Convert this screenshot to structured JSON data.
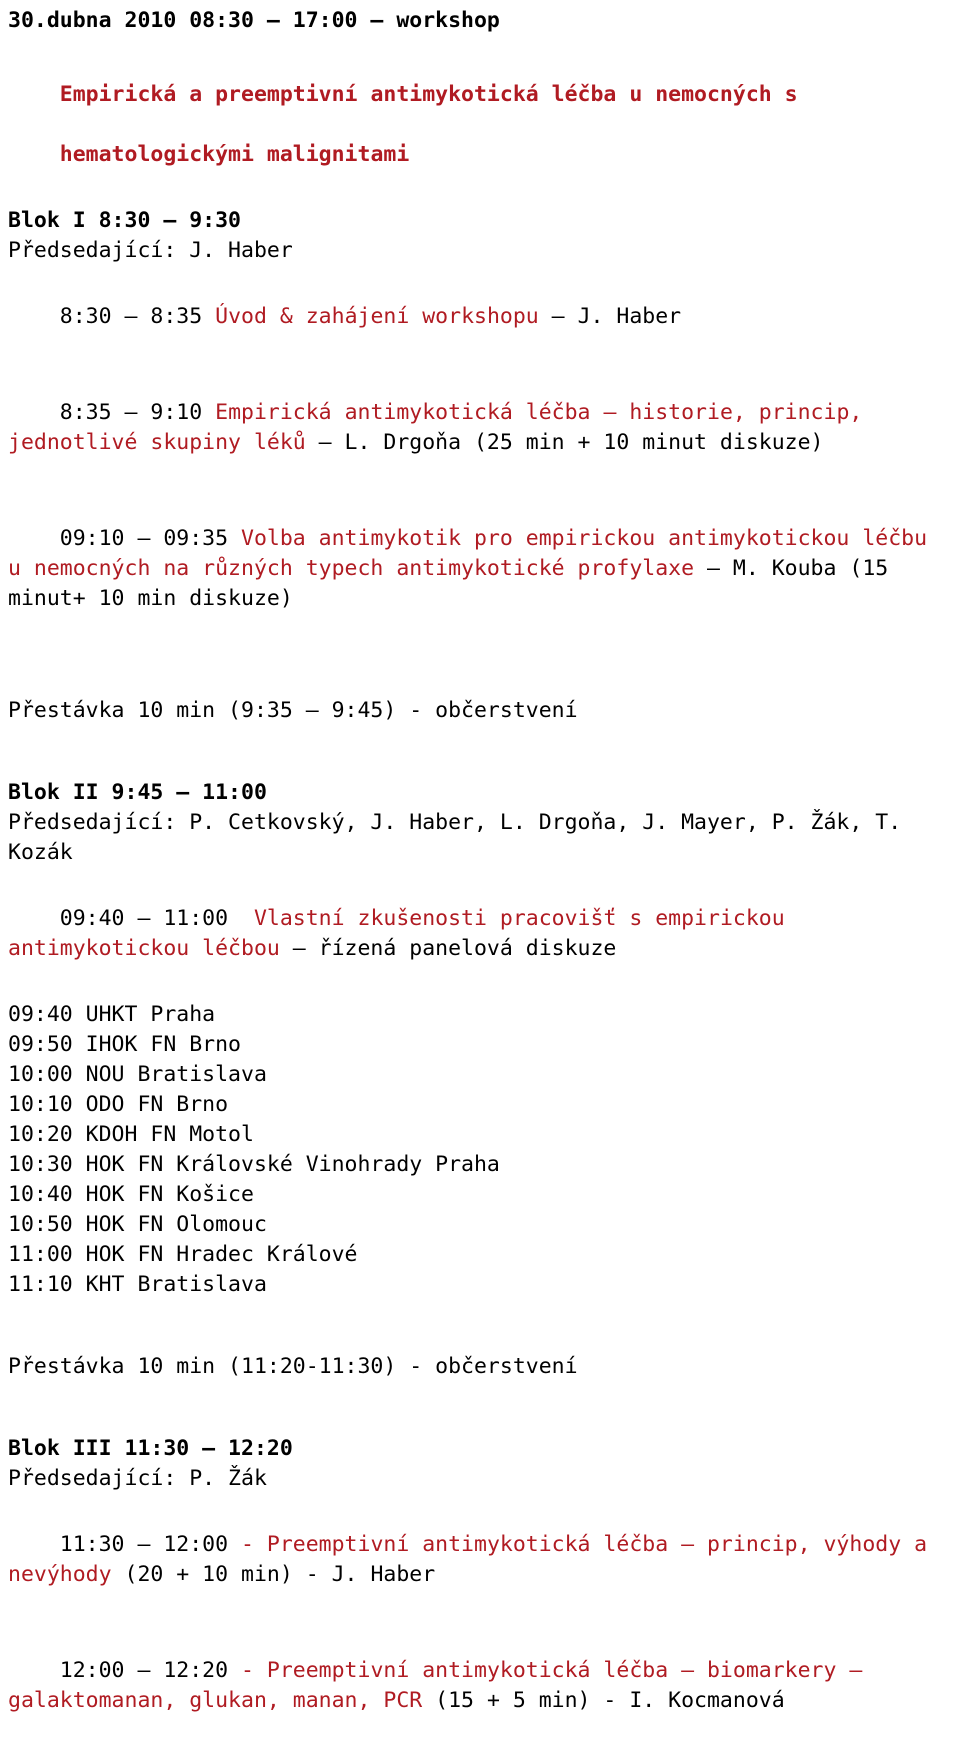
{
  "document": {
    "header_line": "30.dubna 2010 08:30 – 17:00 – workshop",
    "title_line_1": "Empirická a preemptivní antimykotická léčba u nemocných s",
    "title_line_2": "hematologickými malignitami"
  },
  "block_1": {
    "heading": "Blok I 8:30 – 9:30",
    "chair": "Předsedající: J. Haber",
    "items": [
      {
        "time_black": "8:30 – 8:35 ",
        "topic_red": "Úvod & zahájení workshopu",
        "tail_black": " – J. Haber"
      },
      {
        "time_black": "8:35 – 9:10 ",
        "topic_red": "Empirická antimykotická léčba – historie, princip, jednotlivé skupiny léků",
        "tail_black": " – L. Drgoňa (25 min + 10 minut diskuze)"
      },
      {
        "time_black": "09:10 – 09:35 ",
        "topic_red": "Volba antimykotik pro empirickou antimykotickou léčbu u nemocných na různých typech antimykotické profylaxe",
        "tail_black": " – M. Kouba (15 minut+ 10 min diskuze)"
      }
    ]
  },
  "break_1": "Přestávka 10 min (9:35 – 9:45) - občerstvení",
  "block_2": {
    "heading": "Blok II 9:45 – 11:00",
    "chair": "Předsedající: P. Cetkovský, J. Haber, L. Drgoňa, J. Mayer, P. Žák, T. Kozák",
    "items": [
      {
        "time_black": "09:40 – 11:00  ",
        "topic_red": "Vlastní zkušenosti pracovišť s empirickou antimykotickou léčbou",
        "tail_black": " – řízená panelová diskuze"
      }
    ],
    "panel_list": [
      "09:40 UHKT Praha",
      "09:50 IHOK FN Brno",
      "10:00 NOU Bratislava",
      "10:10 ODO FN Brno",
      "10:20 KDOH FN Motol",
      "10:30 HOK FN Královské Vinohrady Praha",
      "10:40 HOK FN Košice",
      "10:50 HOK FN Olomouc",
      "11:00 HOK FN Hradec Králové",
      "11:10 KHT Bratislava"
    ]
  },
  "break_2": "Přestávka 10 min (11:20-11:30) - občerstvení",
  "block_3": {
    "heading": "Blok III 11:30 – 12:20",
    "chair": "Předsedající: P. Žák",
    "items": [
      {
        "time_black": "11:30 – 12:00 ",
        "topic_red": "- Preemptivní antimykotická léčba – princip, výhody a nevýhody",
        "tail_black": " (20 + 10 min) - J. Haber"
      },
      {
        "time_black": "12:00 – 12:20 ",
        "topic_red": "- Preemptivní antimykotická léčba – biomarkery – galaktomanan, glukan, manan, PCR",
        "tail_black": " (15 + 5 min) - I. Kocmanová"
      }
    ]
  },
  "colors": {
    "accent_red": "#B01B22",
    "text_black": "#000000",
    "background": "#FFFFFF"
  }
}
